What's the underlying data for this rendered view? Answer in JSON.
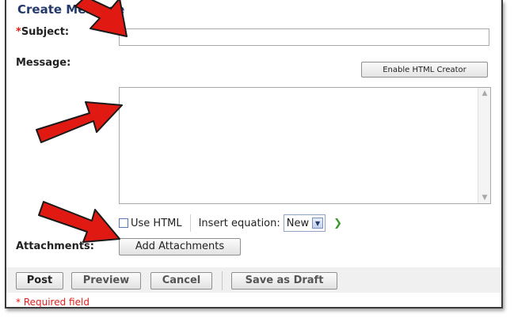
{
  "form": {
    "title": "Create Message",
    "required_star": "*",
    "subject_label": "Subject:",
    "subject_value": "",
    "message_label": "Message:",
    "html_creator_button": "Enable HTML Creator",
    "message_value": "",
    "use_html_label": "Use HTML",
    "use_html_checked": false,
    "insert_equation_label": "Insert equation:",
    "equation_selected": "New",
    "attachments_label": "Attachments:",
    "add_attachments_button": "Add Attachments"
  },
  "footer": {
    "post": "Post",
    "preview": "Preview",
    "cancel": "Cancel",
    "save_draft": "Save as Draft",
    "required_note": "* Required field"
  },
  "colors": {
    "title": "#243a6b",
    "required": "#e0201c",
    "annotation_arrow": "#e01a12"
  }
}
